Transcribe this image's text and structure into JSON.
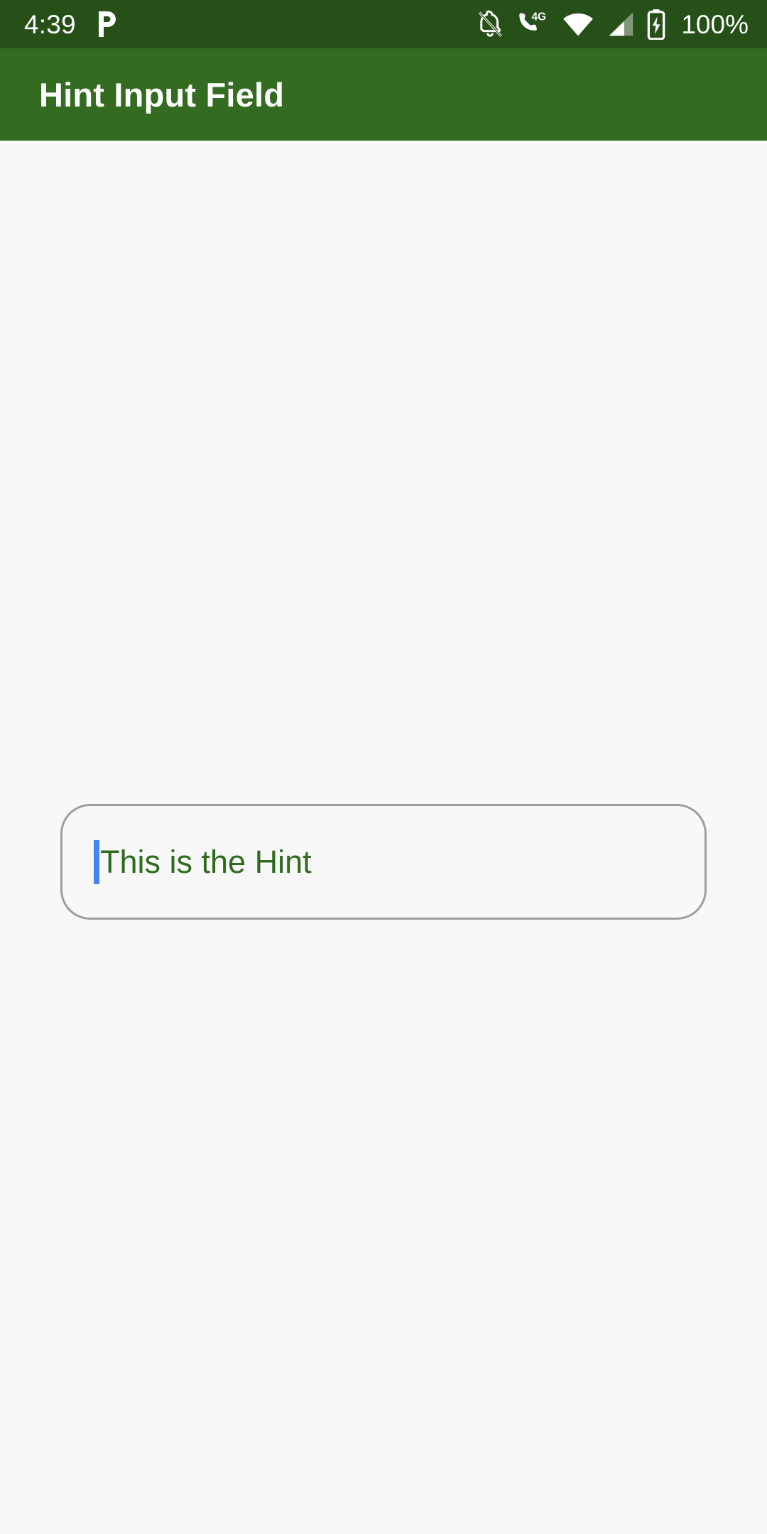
{
  "status_bar": {
    "clock": "4:39",
    "battery_percent": "100%",
    "background_color": "#274F18",
    "foreground_color": "#FFFFFF",
    "notification_icons": [
      {
        "name": "p-app-notification-icon",
        "glyph": "P"
      }
    ],
    "system_icons": [
      {
        "name": "notifications-silenced-icon",
        "label": "silent"
      },
      {
        "name": "mobile-data-4g-icon",
        "label": "4G"
      },
      {
        "name": "wifi-icon",
        "label": "wifi"
      },
      {
        "name": "cellular-signal-icon",
        "label": "signal"
      },
      {
        "name": "battery-charging-icon",
        "label": "charging"
      }
    ]
  },
  "app_bar": {
    "title": "Hint Input Field",
    "background_color": "#336B20",
    "title_color": "#FFFFFF"
  },
  "content": {
    "background_color": "#F8F8F8",
    "input": {
      "value": "",
      "hint": "This is the Hint",
      "hint_color": "#2F6B1F",
      "border_color": "#9E9E9E",
      "cursor_color": "#4285F4",
      "focused": true
    }
  }
}
